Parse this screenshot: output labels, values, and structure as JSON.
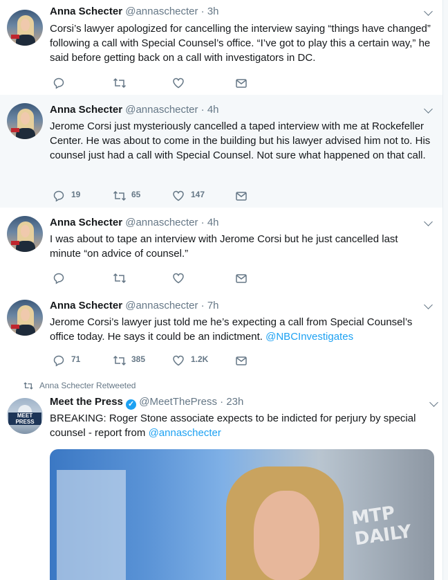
{
  "colors": {
    "accent": "#1da1f2",
    "muted": "#657786",
    "highlight_bg": "#f5f8fa"
  },
  "tweets": [
    {
      "name": "Anna Schecter",
      "handle": "@annaschecter · 3h",
      "text": "Corsi’s lawyer apologized for cancelling the interview saying “things have changed” following a call with Special Counsel’s office. “I’ve got to play this a certain way,” he said before getting back on a call with investigators in DC.",
      "replies": "",
      "retweets": "",
      "likes": ""
    },
    {
      "name": "Anna Schecter",
      "handle": "@annaschecter · 4h",
      "text": "Jerome Corsi just mysteriously cancelled a taped interview with me at Rockefeller Center. He was about to come in the building but his lawyer advised him not to. His counsel just had a call with Special Counsel. Not sure what happened on that call.",
      "replies": "19",
      "retweets": "65",
      "likes": "147"
    },
    {
      "name": "Anna Schecter",
      "handle": "@annaschecter · 4h",
      "text": "I was about to tape an interview with Jerome Corsi but he just cancelled last minute “on advice of counsel.”",
      "replies": "",
      "retweets": "",
      "likes": ""
    },
    {
      "name": "Anna Schecter",
      "handle": "@annaschecter · 7h",
      "text": "Jerome Corsi’s lawyer just told me he’s expecting a call from Special Counsel’s office today. He says it could be an indictment.",
      "link": "@NBCInvestigates",
      "replies": "71",
      "retweets": "385",
      "likes": "1.2K"
    },
    {
      "retweet_label": "Anna Schecter Retweeted",
      "name": "Meet the Press",
      "handle": "@MeetThePress · 23h",
      "text": "BREAKING: Roger Stone associate expects to be indicted for perjury by special counsel - report from",
      "link": "@annaschecter",
      "avatar_text": "MEET PRESS",
      "media_text": "MTP DAILY"
    }
  ]
}
